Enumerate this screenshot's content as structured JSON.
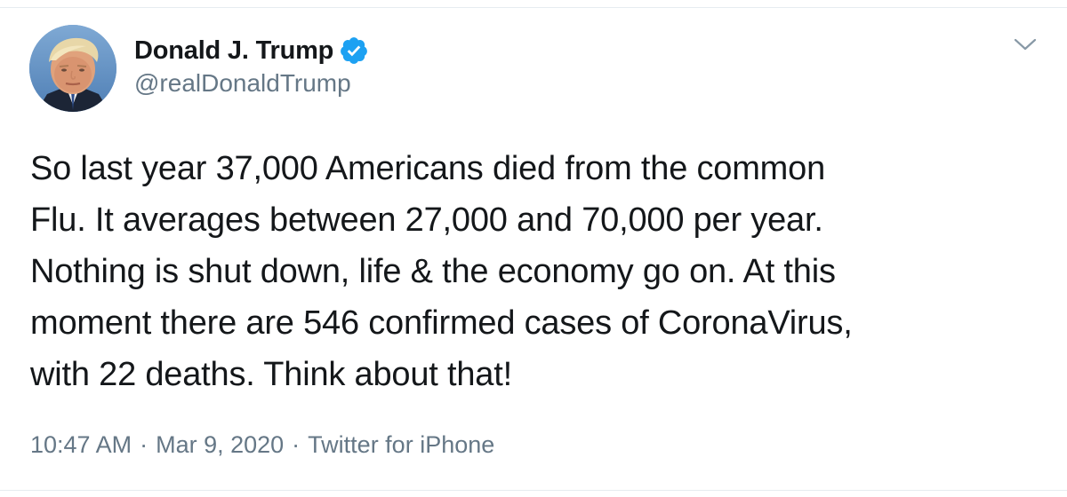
{
  "tweet": {
    "author": {
      "display_name": "Donald J. Trump",
      "handle": "@realDonaldTrump",
      "verified": true,
      "avatar_icon": "profile-photo"
    },
    "text_lines": [
      "So last year 37,000 Americans died from the common",
      "Flu. It averages between 27,000 and 70,000 per year.",
      "Nothing is shut down, life & the economy go on. At this",
      "moment there are 546 confirmed cases of CoronaVirus,",
      "with 22 deaths. Think about that!"
    ],
    "time": "10:47 AM",
    "separator": "·",
    "date": "Mar 9, 2020",
    "source": "Twitter for iPhone",
    "menu_icon": "chevron-down-icon"
  },
  "colors": {
    "text": "#14171a",
    "secondary": "#657786",
    "verified": "#1da1f2",
    "divider": "#e6ecf0"
  }
}
